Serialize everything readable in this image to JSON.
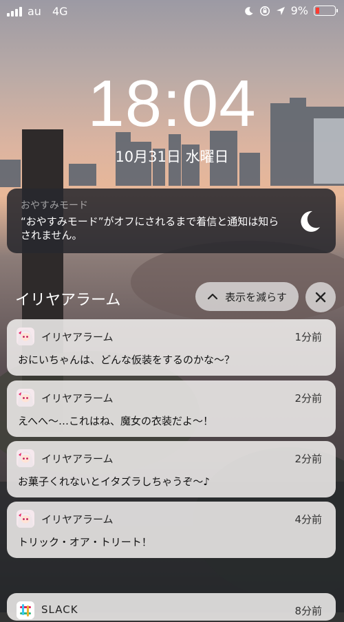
{
  "status_bar": {
    "carrier": "au",
    "network": "4G",
    "battery_text": "9%",
    "battery_level": 0.09,
    "battery_color": "#ff3b30"
  },
  "lock_screen": {
    "time": "18:04",
    "date": "10月31日 水曜日"
  },
  "dnd_banner": {
    "title": "おやすみモード",
    "message": "“おやすみモード”がオフにされるまで着信と通知は知らされません。"
  },
  "group": {
    "title": "イリヤアラーム",
    "show_less_label": "表示を減らす"
  },
  "notifications": [
    {
      "app": "イリヤアラーム",
      "time": "1分前",
      "body": "おにいちゃんは、どんな仮装をするのかな～？"
    },
    {
      "app": "イリヤアラーム",
      "time": "2分前",
      "body": "えへへ～…これはね、魔女の衣装だよ～！"
    },
    {
      "app": "イリヤアラーム",
      "time": "2分前",
      "body": "お菓子くれないとイタズラしちゃうぞ～♪"
    },
    {
      "app": "イリヤアラーム",
      "time": "4分前",
      "body": "トリック・オア・トリート！"
    }
  ],
  "next_notification": {
    "app": "SLACK",
    "time": "8分前"
  },
  "icons": {
    "moon": "moon-icon",
    "chevron": "chevron-up-icon",
    "close": "close-icon",
    "location": "location-arrow-icon",
    "orientation_lock": "orientation-lock-icon"
  }
}
